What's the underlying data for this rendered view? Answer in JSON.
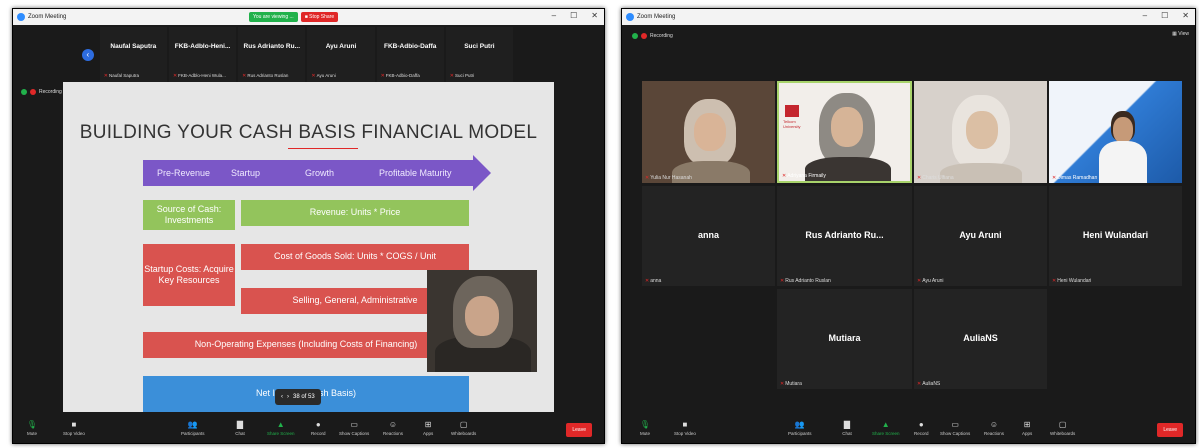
{
  "left": {
    "title": "Zoom Meeting",
    "share_banner": {
      "status": "You are viewing ...",
      "stop_label": "Stop Share"
    },
    "recording_label": "Recording",
    "strip": [
      {
        "name": "Naufal Saputra",
        "label": "Naufal Saputra"
      },
      {
        "name": "FKB-Adblo-Heni...",
        "label": "FKB-Adblo-Heni Wula..."
      },
      {
        "name": "Rus Adrianto Ru...",
        "label": "Rus Adrianto Ruslan"
      },
      {
        "name": "Ayu Aruni",
        "label": "Ayu Aruni"
      },
      {
        "name": "FKB-Adbio-Daffa",
        "label": "FKB-Adbio-Daffa"
      },
      {
        "name": "Suci Putri",
        "label": "Suci Putri"
      }
    ],
    "slide": {
      "title": "BUILDING YOUR CASH BASIS FINANCIAL MODEL",
      "stages": [
        "Pre-Revenue",
        "Startup",
        "Growth",
        "Profitable Maturity"
      ],
      "source_of_cash": "Source of Cash: Investments",
      "revenue": "Revenue: Units * Price",
      "startup_costs": "Startup Costs: Acquire Key Resources",
      "cogs": "Cost of Goods Sold: Units * COGS / Unit",
      "sga": "Selling, General, Administrative",
      "non_operating": "Non-Operating Expenses (Including Costs of Financing)",
      "net_income": "Net Income (Cash Basis)"
    },
    "page_control": {
      "prev": "‹",
      "next": "›",
      "page": "38 of 53"
    }
  },
  "right": {
    "title": "Zoom Meeting",
    "view_label": "View",
    "recording_label": "Recording",
    "video_tiles": [
      {
        "label": "Yulia Nur Hasanah"
      },
      {
        "label": "Adriyana Firmaily"
      },
      {
        "label": "Charis Ulfiana"
      },
      {
        "label": "Dimas Ramadhan"
      }
    ],
    "name_tiles": [
      {
        "name": "anna",
        "label": "anna"
      },
      {
        "name": "Rus Adrianto Ru...",
        "label": "Rus Adrianto Ruslan"
      },
      {
        "name": "Ayu Aruni",
        "label": "Ayu Aruni"
      },
      {
        "name": "Heni Wulandari",
        "label": "Heni Wulandari"
      },
      {
        "name": "Mutiara",
        "label": "Mutiara"
      },
      {
        "name": "AuliaNS",
        "label": "AuliaNS"
      }
    ],
    "telkom_label": "Telkom University"
  },
  "toolbar": {
    "items": [
      "Mute",
      "Stop Video",
      "Participants",
      "Chat",
      "Share Screen",
      "Record",
      "Show Captions",
      "Reactions",
      "Apps",
      "Whiteboards"
    ],
    "participants_count": "31",
    "leave_label": "Leave"
  },
  "colors": {
    "accent": "#2d8cff",
    "leave": "#e02828",
    "share": "#21b14b",
    "arrow": "#7b57c7",
    "green_box": "#93c45c",
    "red_box": "#d9534f",
    "blue_box": "#3b8fd9"
  }
}
